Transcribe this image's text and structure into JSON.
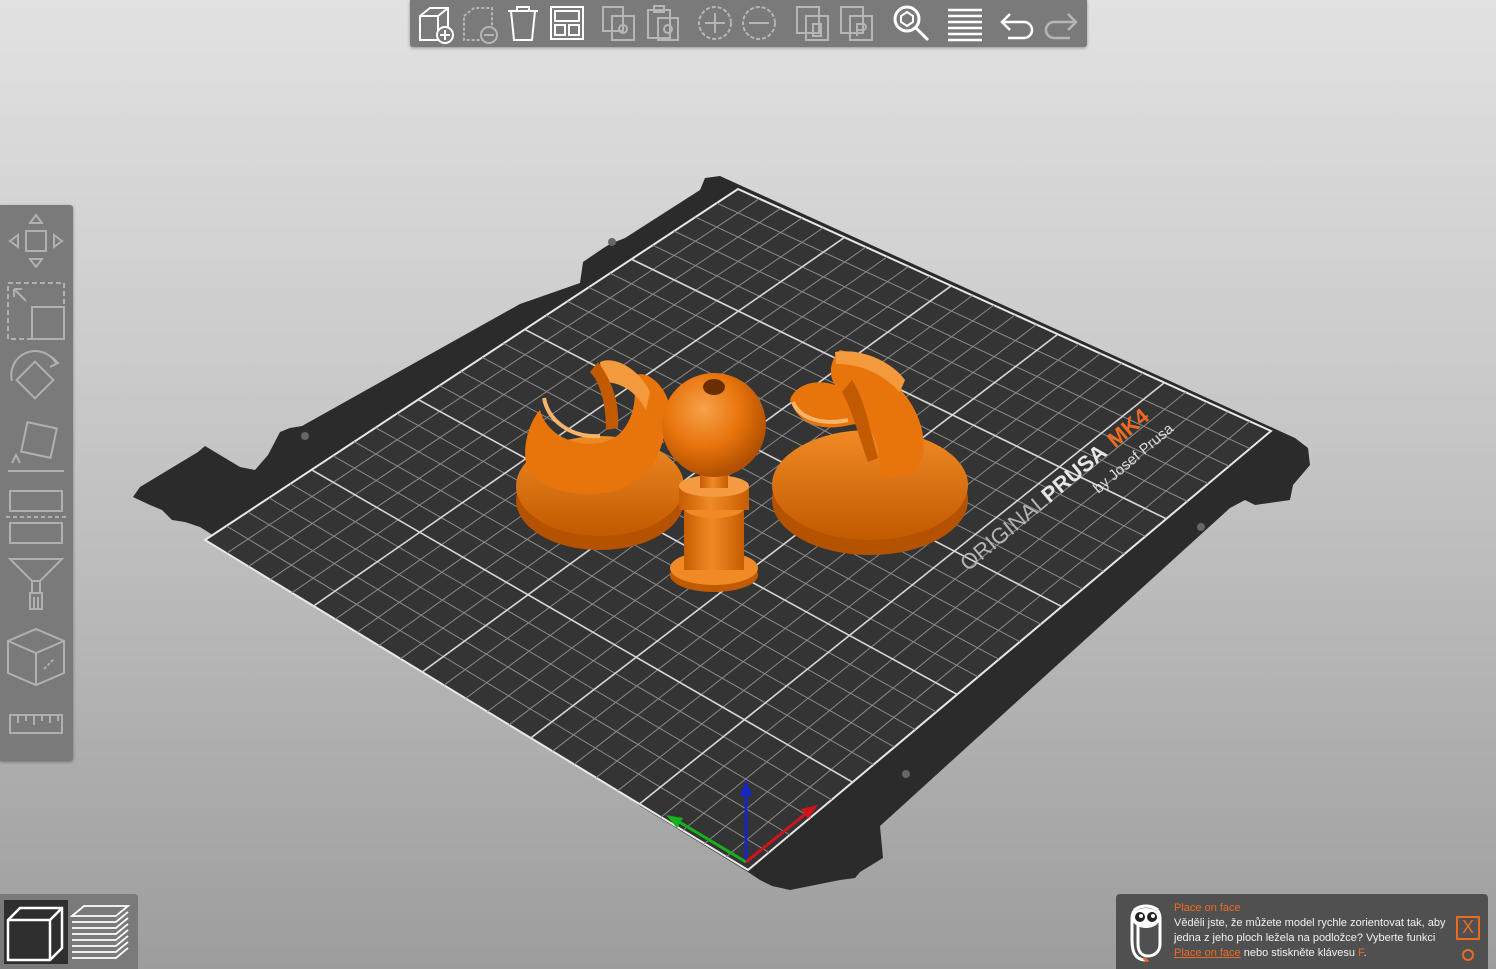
{
  "toolbar": {
    "buttons": [
      {
        "name": "add-button",
        "icon": "cube-plus-icon",
        "enabled": true
      },
      {
        "name": "delete-button",
        "icon": "cube-minus-icon",
        "enabled": false
      },
      {
        "name": "delete-all-button",
        "icon": "trash-icon",
        "enabled": true
      },
      {
        "name": "arrange-button",
        "icon": "arrange-icon",
        "enabled": true
      },
      {
        "name": "copy-button",
        "icon": "copy-icon",
        "enabled": false
      },
      {
        "name": "paste-button",
        "icon": "paste-icon",
        "enabled": false
      },
      {
        "name": "add-instance-button",
        "icon": "plus-circle-icon",
        "enabled": false
      },
      {
        "name": "remove-instance-button",
        "icon": "minus-circle-icon",
        "enabled": false
      },
      {
        "name": "split-objects-button",
        "icon": "split-objects-icon",
        "enabled": false
      },
      {
        "name": "split-parts-button",
        "icon": "split-parts-icon",
        "enabled": false
      },
      {
        "name": "search-button",
        "icon": "search-icon",
        "enabled": true
      },
      {
        "name": "layers-editing-button",
        "icon": "layers-icon",
        "enabled": true
      },
      {
        "name": "undo-button",
        "icon": "undo-icon",
        "enabled": true
      },
      {
        "name": "redo-button",
        "icon": "redo-icon",
        "enabled": false
      }
    ]
  },
  "sidebar": {
    "tools": [
      {
        "name": "move-tool",
        "icon": "move-icon"
      },
      {
        "name": "scale-tool",
        "icon": "scale-icon"
      },
      {
        "name": "rotate-tool",
        "icon": "rotate-icon"
      },
      {
        "name": "place-on-face-tool",
        "icon": "place-on-face-icon"
      },
      {
        "name": "cut-tool",
        "icon": "cut-icon"
      },
      {
        "name": "paint-supports-tool",
        "icon": "paint-brush-icon"
      },
      {
        "name": "seam-painting-tool",
        "icon": "cube-paint-icon"
      },
      {
        "name": "measure-tool",
        "icon": "ruler-icon"
      }
    ]
  },
  "view": {
    "modes": [
      {
        "name": "3d-view",
        "icon": "cube-icon",
        "active": true
      },
      {
        "name": "preview",
        "icon": "layers-stack-icon",
        "active": false
      }
    ]
  },
  "bed": {
    "brand_line": "ORIGINAL",
    "brand_strong": "PRUSA",
    "model": "MK4",
    "maker": "by Josef Prusa"
  },
  "notification": {
    "title": "Place on face",
    "text_before": "Věděli jste, že můžete model rychle zorientovat tak, aby jedna z jeho ploch ležela na podložce? Vyberte funkci",
    "link": "Place on face",
    "text_after": "nebo stiskněte klávesu",
    "key": "F",
    "period": ".",
    "close_label": "X"
  },
  "colors": {
    "model": "#e8740c",
    "accent": "#ed6b21",
    "bed": "#2d2d2d",
    "panel": "#7a7a7a",
    "axis_x": "#d0141e",
    "axis_y": "#17b21b",
    "axis_z": "#1525c8"
  }
}
